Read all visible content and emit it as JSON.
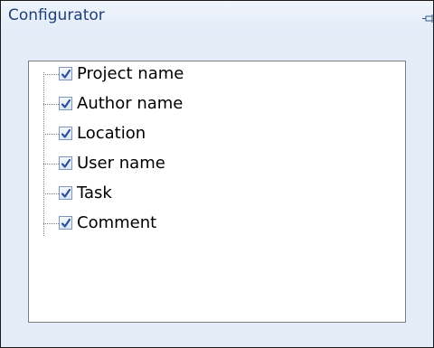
{
  "panel": {
    "title": "Configurator",
    "pin_icon": "pin-icon"
  },
  "tree": {
    "items": [
      {
        "label": "Project name",
        "checked": true
      },
      {
        "label": "Author name",
        "checked": true
      },
      {
        "label": "Location",
        "checked": true
      },
      {
        "label": "User name",
        "checked": true
      },
      {
        "label": "Task",
        "checked": true
      },
      {
        "label": "Comment",
        "checked": true
      }
    ]
  },
  "colors": {
    "title_text": "#1f3f78",
    "checkmark": "#2b4fa0",
    "panel_background": "#e3ecf7"
  }
}
